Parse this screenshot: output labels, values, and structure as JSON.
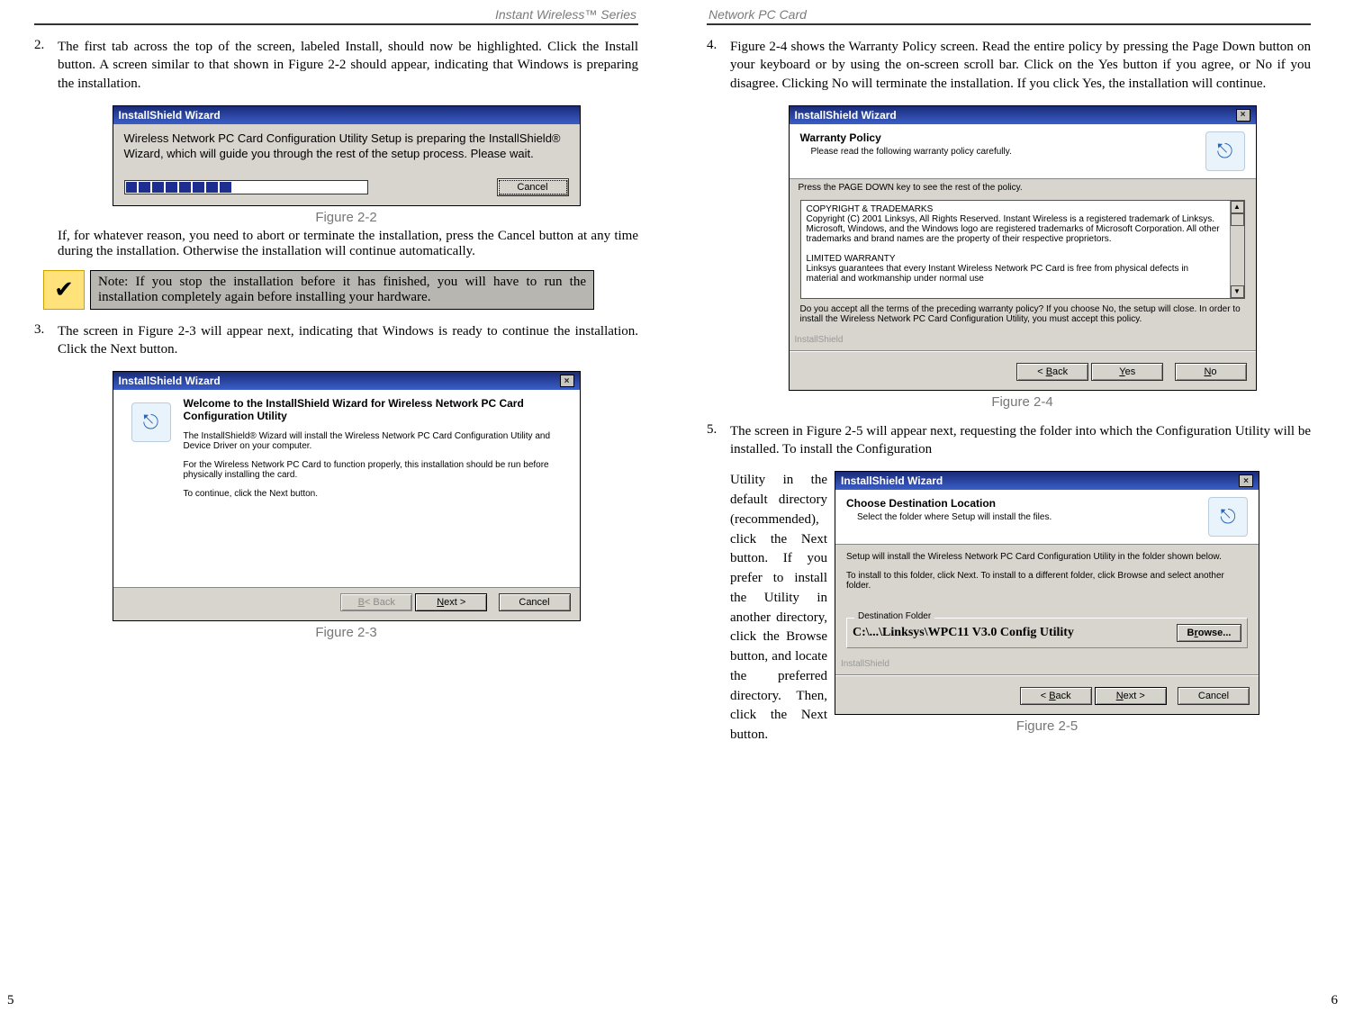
{
  "header": {
    "left": "Instant Wireless™ Series",
    "right": "Network PC Card"
  },
  "left_page": {
    "step2": {
      "num": "2.",
      "text": "The first tab across the top of the screen, labeled Install, should now be highlighted. Click the Install button. A screen similar to that shown in Figure 2-2 should appear, indicating that Windows is preparing the installation."
    },
    "fig22": {
      "title": "InstallShield Wizard",
      "body": "Wireless Network PC Card Configuration Utility Setup is preparing the InstallShield® Wizard, which will guide you through the rest of the setup process. Please wait.",
      "cancel": "Cancel",
      "caption": "Figure 2-2"
    },
    "after2": "If, for whatever reason, you need to abort or terminate the installation, press the Cancel button at any time during the installation. Otherwise the installation will continue automatically.",
    "note": "Note: If you stop the installation before it has finished, you will have to run the installation completely again before installing your hardware.",
    "step3": {
      "num": "3.",
      "text": "The screen in Figure 2-3 will appear next, indicating that Windows is ready to continue the installation. Click the Next button."
    },
    "fig23": {
      "title": "InstallShield Wizard",
      "heading": "Welcome to the InstallShield Wizard for Wireless Network PC Card Configuration Utility",
      "p1": "The InstallShield® Wizard will install the Wireless Network PC Card Configuration Utility and Device Driver on your computer.",
      "p2": "For the Wireless Network PC Card to function properly, this installation should be run before physically installing the card.",
      "p3": "To continue, click the Next button.",
      "back": "< Back",
      "next": "Next >",
      "cancel": "Cancel",
      "caption": "Figure 2-3"
    },
    "pagenum": "5"
  },
  "right_page": {
    "step4": {
      "num": "4.",
      "text": "Figure 2-4 shows the Warranty Policy screen. Read the entire policy by pressing the Page Down button on your keyboard or by using the on-screen scroll bar. Click on the Yes button if you agree, or No if you disagree. Clicking No will terminate the installation. If you click Yes, the installation will continue."
    },
    "fig24": {
      "title": "InstallShield Wizard",
      "heading": "Warranty Policy",
      "sub": "Please read the following warranty policy carefully.",
      "press": "Press the PAGE DOWN key to see the rest of the policy.",
      "eula1": "COPYRIGHT & TRADEMARKS",
      "eula2": "Copyright (C) 2001 Linksys, All Rights Reserved. Instant Wireless is a registered trademark of Linksys. Microsoft, Windows, and the Windows logo are registered trademarks of Microsoft Corporation. All other trademarks and brand names are the property of their respective proprietors.",
      "eula3": "LIMITED WARRANTY",
      "eula4": "Linksys guarantees that every Instant Wireless Network PC Card is free from physical defects in material and workmanship under normal use",
      "accept": "Do you accept all the terms of the preceding warranty policy? If you choose No, the setup will close. In order to install the Wireless Network PC Card Configuration Utility, you must accept this policy.",
      "brand": "InstallShield",
      "back": "< Back",
      "yes": "Yes",
      "no": "No",
      "caption": "Figure 2-4"
    },
    "step5": {
      "num": "5.",
      "lead": "The screen in Figure 2-5 will appear next, requesting the folder into which the Configuration Utility will be installed.  To install the Configuration",
      "side": "Utility in the default directory (recommended), click the Next button. If you prefer to install the Utility in another directory, click the Browse button, and locate the preferred directory. Then, click the Next button."
    },
    "fig25": {
      "title": "InstallShield Wizard",
      "heading": "Choose Destination Location",
      "sub": "Select the folder where Setup will install the files.",
      "p1": "Setup will install the Wireless Network PC Card Configuration Utility in the folder shown below.",
      "p2": "To install to this folder, click Next. To install to a different folder, click Browse and select another folder.",
      "dest_legend": "Destination Folder",
      "dest_path": "C:\\...\\Linksys\\WPC11 V3.0 Config Utility",
      "browse": "Browse...",
      "brand": "InstallShield",
      "back": "< Back",
      "next": "Next >",
      "cancel": "Cancel",
      "caption": "Figure 2-5"
    },
    "pagenum": "6"
  }
}
